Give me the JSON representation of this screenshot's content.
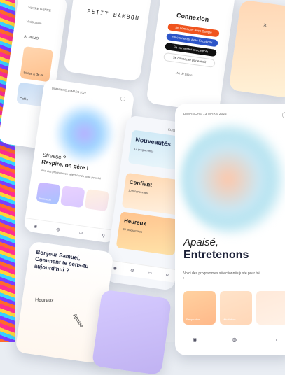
{
  "menu_card": {
    "labels": [
      "VOTRE GENRE",
      "Verification",
      "ALBUMS"
    ],
    "chip_1": "Stress & de la",
    "chip_2": "Cafés"
  },
  "brand_card": {
    "logo": "PETIT BAMBOU"
  },
  "login_card": {
    "title": "Connexion",
    "buttons": [
      {
        "label": "Se connecter avec Google",
        "color": "#f0541e"
      },
      {
        "label": "Se connecter avec Facebook",
        "color": "#2d55c8"
      },
      {
        "label": "Se connecter avec Apple",
        "color": "#111111"
      },
      {
        "label": "Se connecter par e-mail",
        "color": "#ffffff"
      }
    ],
    "footer": "Mot de passe"
  },
  "stress_card": {
    "date": "DIMANCHE 13 MARS 2022",
    "line1": "Stressé ?",
    "line2": "Respire, on gère !",
    "subtitle": "Voici des programmes sélectionnés juste pour toi :",
    "tiles": [
      "Respiration",
      "",
      ""
    ],
    "nav": [
      "Accueil",
      "Explorer",
      "Mes",
      "Profil"
    ]
  },
  "mood_list_card": {
    "header": "COLLECTIONS",
    "items": [
      {
        "title": "Nouveautés",
        "sub": "12 programmes"
      },
      {
        "title": "Confiant",
        "sub": "10 programmes"
      },
      {
        "title": "Heureux",
        "sub": "20 programmes"
      }
    ],
    "nav": [
      "Accueil",
      "Explorer",
      "Mes",
      "Profil"
    ]
  },
  "greeting_card": {
    "text": "Bonjour Samuel, Comment te sens-tu aujourd'hui ?",
    "mood_1": "Heureux",
    "mood_2": "Apaisé"
  },
  "hero_card": {
    "date": "DIMANCHE 13 MARS 2022",
    "line1": "Apaisé,",
    "line2": "Entretenons",
    "subtitle": "Voici des programmes sélectionnés juste pour toi :",
    "tiles": [
      "Respiration",
      "Méditation",
      ""
    ]
  },
  "peach_card": {}
}
